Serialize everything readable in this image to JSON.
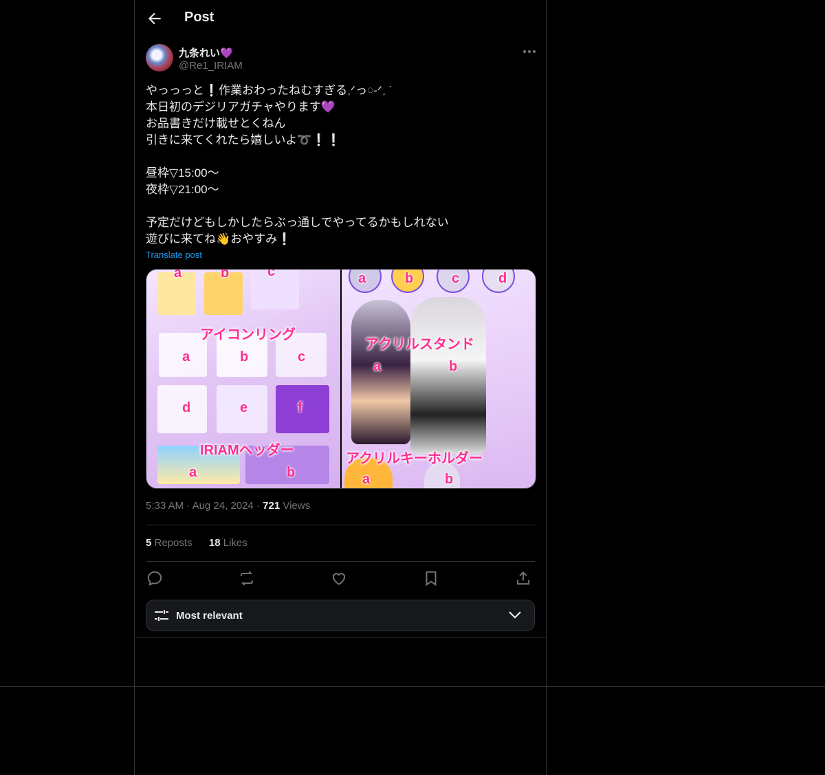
{
  "header": {
    "title": "Post"
  },
  "post": {
    "author_name": "九条れい",
    "author_emoji": "💜",
    "handle": "@Re1_IRIAM",
    "text": "やっっっと❕作業おわったねむすぎる𓈒ᐟっ𓏸-ᐟ𓈒 ˙\n本日初のデジリアガチャやります💜\nお品書きだけ載せとくねん\n引きに来てくれたら嬉しいよ➰❕❕\n\n昼枠▽15:00〜\n夜枠▽21:00〜\n\n予定だけどもしかしたらぶっ通しでやってるかもしれない\n遊びに来てね👋おやすみ❕",
    "translate": "Translate post",
    "time": "5:33 AM",
    "date": "Aug 24, 2024",
    "views_count": "721",
    "views_label": "Views",
    "reposts_count": "5",
    "reposts_label": "Reposts",
    "likes_count": "18",
    "likes_label": "Likes"
  },
  "media": {
    "left_title_1": "アイコンリング",
    "left_title_2": "IRIAMヘッダー",
    "right_title_1": "アクリルスタンド",
    "right_title_2": "アクリルキーホルダー",
    "letters": [
      "a",
      "b",
      "c",
      "d",
      "e",
      "f"
    ]
  },
  "sort": {
    "label": "Most relevant"
  },
  "colors": {
    "accent": "#1d9bf0",
    "label_pink": "#ff2c8f",
    "purple_heart": "#a78bda"
  }
}
